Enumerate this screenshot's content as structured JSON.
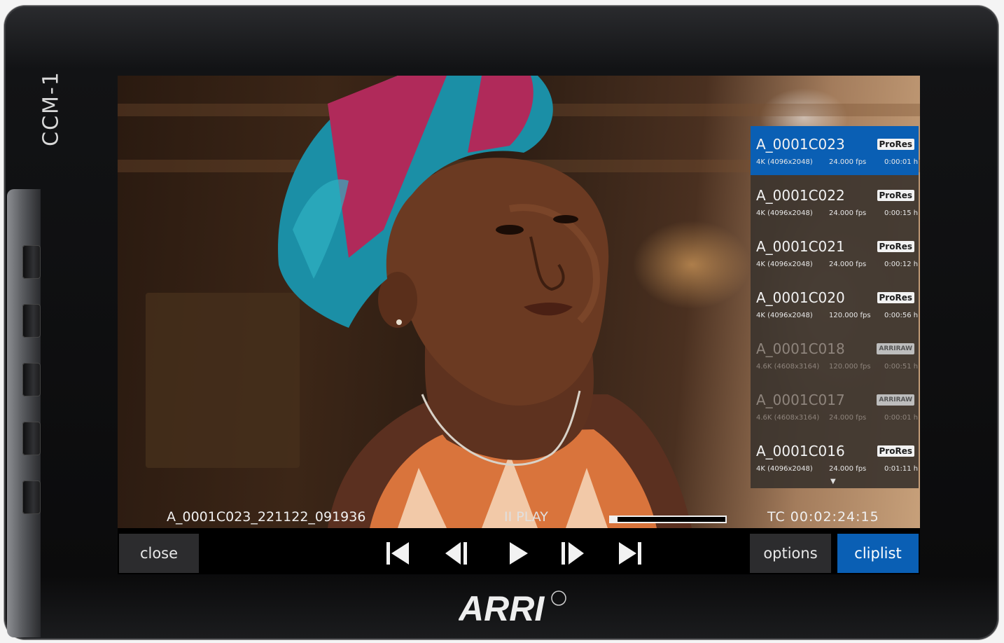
{
  "device": {
    "model": "CCM-1",
    "brand": "ARRI"
  },
  "playback": {
    "filename": "A_0001C023_221122_091936",
    "state": "II PLAY",
    "progress": 0.06,
    "timecode": "TC  00:02:24:15"
  },
  "clip_list": [
    {
      "name": "A_0001C023",
      "codec": "ProRes",
      "resolution": "4K (4096x2048)",
      "fps": "24.000 fps",
      "duration": "0:00:01 h",
      "selected": true,
      "dimmed": false
    },
    {
      "name": "A_0001C022",
      "codec": "ProRes",
      "resolution": "4K (4096x2048)",
      "fps": "24.000 fps",
      "duration": "0:00:15 h",
      "selected": false,
      "dimmed": false
    },
    {
      "name": "A_0001C021",
      "codec": "ProRes",
      "resolution": "4K (4096x2048)",
      "fps": "24.000 fps",
      "duration": "0:00:12 h",
      "selected": false,
      "dimmed": false
    },
    {
      "name": "A_0001C020",
      "codec": "ProRes",
      "resolution": "4K (4096x2048)",
      "fps": "120.000 fps",
      "duration": "0:00:56 h",
      "selected": false,
      "dimmed": false
    },
    {
      "name": "A_0001C018",
      "codec": "ARRIRAW",
      "resolution": "4.6K (4608x3164)",
      "fps": "120.000 fps",
      "duration": "0:00:51 h",
      "selected": false,
      "dimmed": true
    },
    {
      "name": "A_0001C017",
      "codec": "ARRIRAW",
      "resolution": "4.6K (4608x3164)",
      "fps": "24.000 fps",
      "duration": "0:00:01 h",
      "selected": false,
      "dimmed": true
    },
    {
      "name": "A_0001C016",
      "codec": "ProRes",
      "resolution": "4K (4096x2048)",
      "fps": "24.000 fps",
      "duration": "0:01:11 h",
      "selected": false,
      "dimmed": false
    }
  ],
  "buttons": {
    "close": "close",
    "options": "options",
    "cliplist": "cliplist"
  },
  "transport_icons": [
    "skip-to-start-icon",
    "step-back-icon",
    "play-icon",
    "step-forward-icon",
    "skip-to-end-icon"
  ],
  "colors": {
    "accent": "#0a5fb4",
    "button_bg": "#2c2c2e",
    "panel_bg": "#3c342e"
  }
}
